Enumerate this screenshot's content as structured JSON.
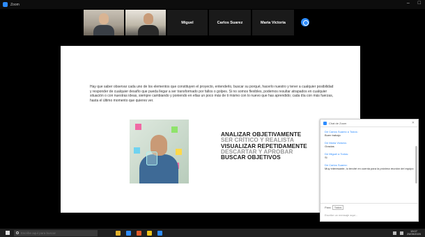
{
  "window": {
    "title": "Zoom",
    "controls": [
      "–",
      "□"
    ]
  },
  "participants": [
    {
      "name": "Miguel"
    },
    {
      "name": "Carlos Suarez"
    },
    {
      "name": "Maria Victoria"
    }
  ],
  "slide": {
    "paragraph": "Hay que saber observar cada uno de los elementos que constituyen el proyecto, entenderlo, buscar su porqué, hacerlo nuestro y tener a cualquier posibilidad y responder de cualquier desafío que pueda llegar a ser transformado por fallos o golpes. Si no somos flexibles, podemos resultar atrapados en cualquier situación o con nuestras ideas, siempre cambiando y poniendo en ellas un poco más de ti mismo con lo nuevo que has aprendido; cada día con más fuerzas, hasta el último momento que quieres ver.",
    "bullets": [
      {
        "text": "ANALIZAR OBJETIVAMENTE",
        "tone": "dark"
      },
      {
        "text": "SER CRÍTICO Y REALISTA",
        "tone": "muted"
      },
      {
        "text": "VISUALIZAR REPETIDAMENTE",
        "tone": "dark"
      },
      {
        "text": "DESCARTAR Y APROBAR",
        "tone": "muted"
      },
      {
        "text": "BUSCAR OBJETIVOS",
        "tone": "dark"
      }
    ],
    "sticky_note_colors": [
      "#f06aa5",
      "#8fe36b",
      "#ffd94a",
      "#6fd3f0"
    ]
  },
  "chat": {
    "title": "Chat de Zoom",
    "messages": [
      {
        "from": "De Carlos Suarez a Todos:",
        "text": "Buen trabajo"
      },
      {
        "from": "De Maria Victoria:",
        "text": "Gracias"
      },
      {
        "from": "De Miguel a Todos:",
        "text": "Si"
      },
      {
        "from": "De Carlos Suarez:",
        "text": "Muy interesante, lo tendré en cuenta para la próxima reunión del equipo"
      }
    ],
    "to_label": "Para:",
    "to_value": "Todos",
    "input_placeholder": "Escribe un mensaje aquí..."
  },
  "taskbar": {
    "search_placeholder": "Escribe aquí para buscar",
    "app_colors": [
      "#e1b12c",
      "#2d8cff",
      "#e05a2a",
      "#f0c419",
      "#2d8cff"
    ],
    "time": "19:07",
    "date": "25/05/2020"
  },
  "colors": {
    "zoom_blue": "#2d8cff",
    "taskbar": "#202020",
    "background": "#000000"
  }
}
